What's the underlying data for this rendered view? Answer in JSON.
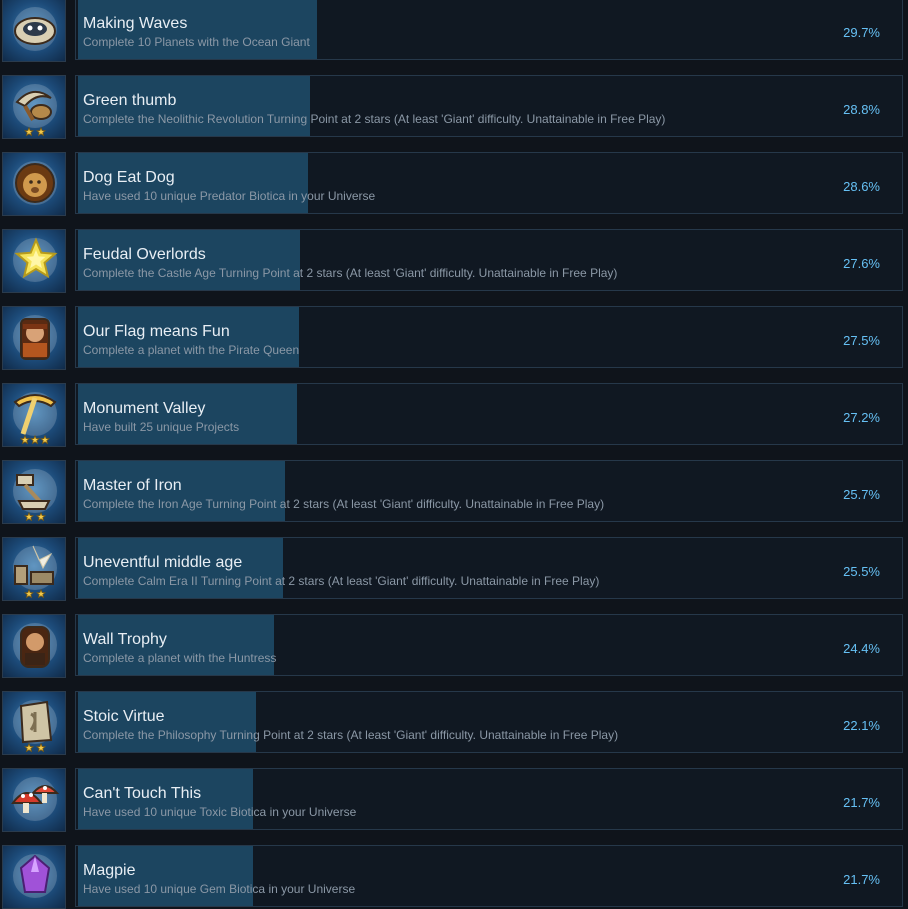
{
  "achievements": [
    {
      "title": "Making Waves",
      "description": "Complete 10 Planets with the Ocean Giant",
      "percent_label": "29.7%",
      "percent": 29.7,
      "icon": "ocean-giant-icon",
      "stars": 0
    },
    {
      "title": "Green thumb",
      "description": "Complete the Neolithic Revolution Turning Point at 2 stars (At least 'Giant' difficulty. Unattainable in Free Play)",
      "percent_label": "28.8%",
      "percent": 28.8,
      "icon": "sickle-grain-icon",
      "stars": 2
    },
    {
      "title": "Dog Eat Dog",
      "description": "Have used 10 unique Predator Biotica in your Universe",
      "percent_label": "28.6%",
      "percent": 28.6,
      "icon": "lion-icon",
      "stars": 0
    },
    {
      "title": "Feudal Overlords",
      "description": "Complete the Castle Age Turning Point at 2 stars (At least 'Giant' difficulty. Unattainable in Free Play)",
      "percent_label": "27.6%",
      "percent": 27.6,
      "icon": "star-icon",
      "stars": 0
    },
    {
      "title": "Our Flag means Fun",
      "description": "Complete a planet with the Pirate Queen",
      "percent_label": "27.5%",
      "percent": 27.5,
      "icon": "pirate-queen-icon",
      "stars": 0
    },
    {
      "title": "Monument Valley",
      "description": "Have built 25 unique Projects",
      "percent_label": "27.2%",
      "percent": 27.2,
      "icon": "pickaxe-icon",
      "stars": 3
    },
    {
      "title": "Master of Iron",
      "description": "Complete the Iron Age Turning Point at 2 stars (At least 'Giant' difficulty. Unattainable in Free Play)",
      "percent_label": "25.7%",
      "percent": 25.7,
      "icon": "hammer-anvil-icon",
      "stars": 2
    },
    {
      "title": "Uneventful middle age",
      "description": "Complete Calm Era II Turning Point at 2 stars (At least 'Giant' difficulty. Unattainable in Free Play)",
      "percent_label": "25.5%",
      "percent": 25.5,
      "icon": "broken-ruins-icon",
      "stars": 2
    },
    {
      "title": "Wall Trophy",
      "description": "Complete a planet with the Huntress",
      "percent_label": "24.4%",
      "percent": 24.4,
      "icon": "huntress-icon",
      "stars": 0
    },
    {
      "title": "Stoic Virtue",
      "description": "Complete the Philosophy Turning Point at 2 stars (At least 'Giant' difficulty. Unattainable in Free Play)",
      "percent_label": "22.1%",
      "percent": 22.1,
      "icon": "stone-tablet-icon",
      "stars": 2
    },
    {
      "title": "Can't Touch This",
      "description": "Have used 10 unique Toxic Biotica in your Universe",
      "percent_label": "21.7%",
      "percent": 21.7,
      "icon": "mushrooms-icon",
      "stars": 0
    },
    {
      "title": "Magpie",
      "description": "Have used 10 unique Gem Biotica in your Universe",
      "percent_label": "21.7%",
      "percent": 21.7,
      "icon": "purple-gem-icon",
      "stars": 0
    }
  ],
  "colors": {
    "background": "#0f141b",
    "panel": "#101822",
    "progress_fill": "#1c4560",
    "title_text": "#e8eef4",
    "description_text": "#8b98a6",
    "percent_text": "#66c0f4",
    "icon_star": "#f2c94c"
  }
}
